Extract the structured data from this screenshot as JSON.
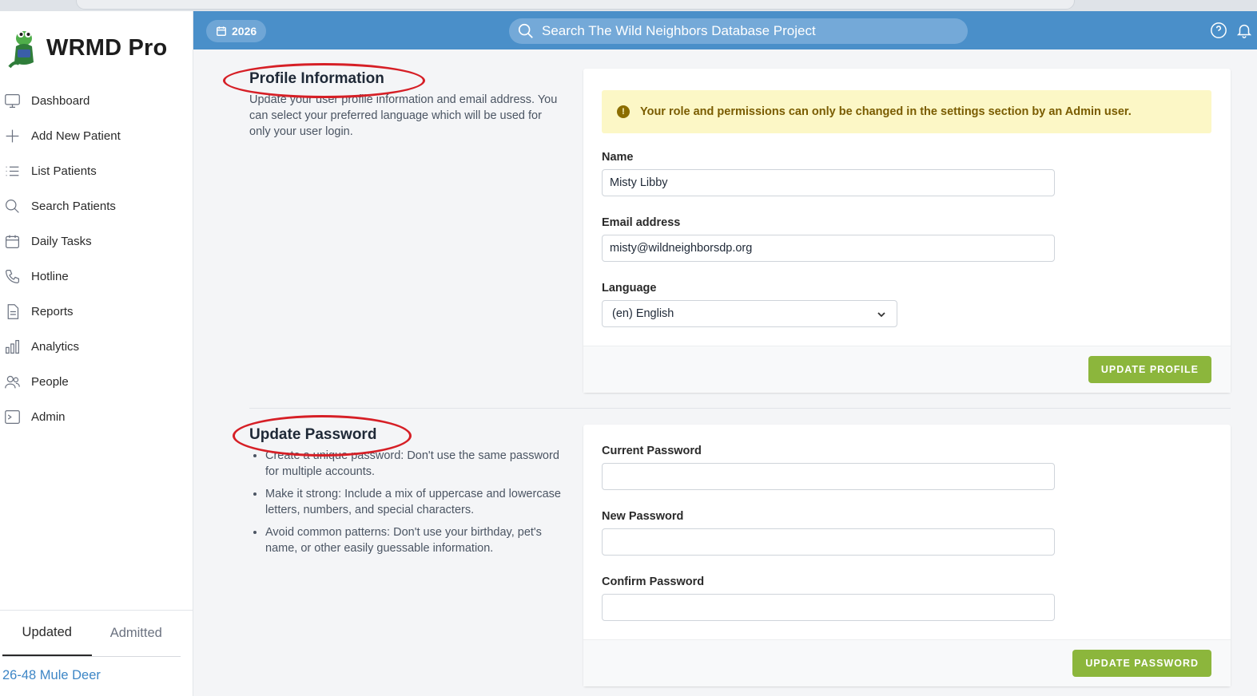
{
  "app": {
    "name": "WRMD Pro"
  },
  "sidebar": {
    "items": [
      {
        "label": "Dashboard",
        "icon": "monitor-icon"
      },
      {
        "label": "Add New Patient",
        "icon": "plus-icon"
      },
      {
        "label": "List Patients",
        "icon": "list-icon"
      },
      {
        "label": "Search Patients",
        "icon": "search-icon"
      },
      {
        "label": "Daily Tasks",
        "icon": "calendar-icon"
      },
      {
        "label": "Hotline",
        "icon": "phone-icon"
      },
      {
        "label": "Reports",
        "icon": "document-icon"
      },
      {
        "label": "Analytics",
        "icon": "bar-chart-icon"
      },
      {
        "label": "People",
        "icon": "users-icon"
      },
      {
        "label": "Admin",
        "icon": "terminal-icon"
      }
    ],
    "tabs": [
      "Updated",
      "Admitted"
    ],
    "active_tab": "Updated",
    "recent_patient": "26-48 Mule Deer"
  },
  "topbar": {
    "year": "2026",
    "search_placeholder": "Search The Wild Neighbors Database Project"
  },
  "profile": {
    "title": "Profile Information",
    "description": "Update your user profile information and email address. You can select your preferred language which will be used for only your user login.",
    "alert": "Your role and permissions can only be changed in the settings section by an Admin user.",
    "name_label": "Name",
    "name_value": "Misty Libby",
    "email_label": "Email address",
    "email_value": "misty@wildneighborsdp.org",
    "language_label": "Language",
    "language_value": "(en) English",
    "submit_label": "UPDATE PROFILE"
  },
  "password": {
    "title": "Update Password",
    "tips": [
      "Create a unique password: Don't use the same password for multiple accounts.",
      "Make it strong: Include a mix of uppercase and lowercase letters, numbers, and special characters.",
      "Avoid common patterns: Don't use your birthday, pet's name, or other easily guessable information."
    ],
    "current_label": "Current Password",
    "new_label": "New Password",
    "confirm_label": "Confirm Password",
    "submit_label": "UPDATE PASSWORD"
  },
  "colors": {
    "topbar": "#4a8fc9",
    "accent_green": "#8cb63c",
    "alert_bg": "#fcf7c6",
    "annotation_red": "#d61f26",
    "link_blue": "#3d86c6"
  }
}
